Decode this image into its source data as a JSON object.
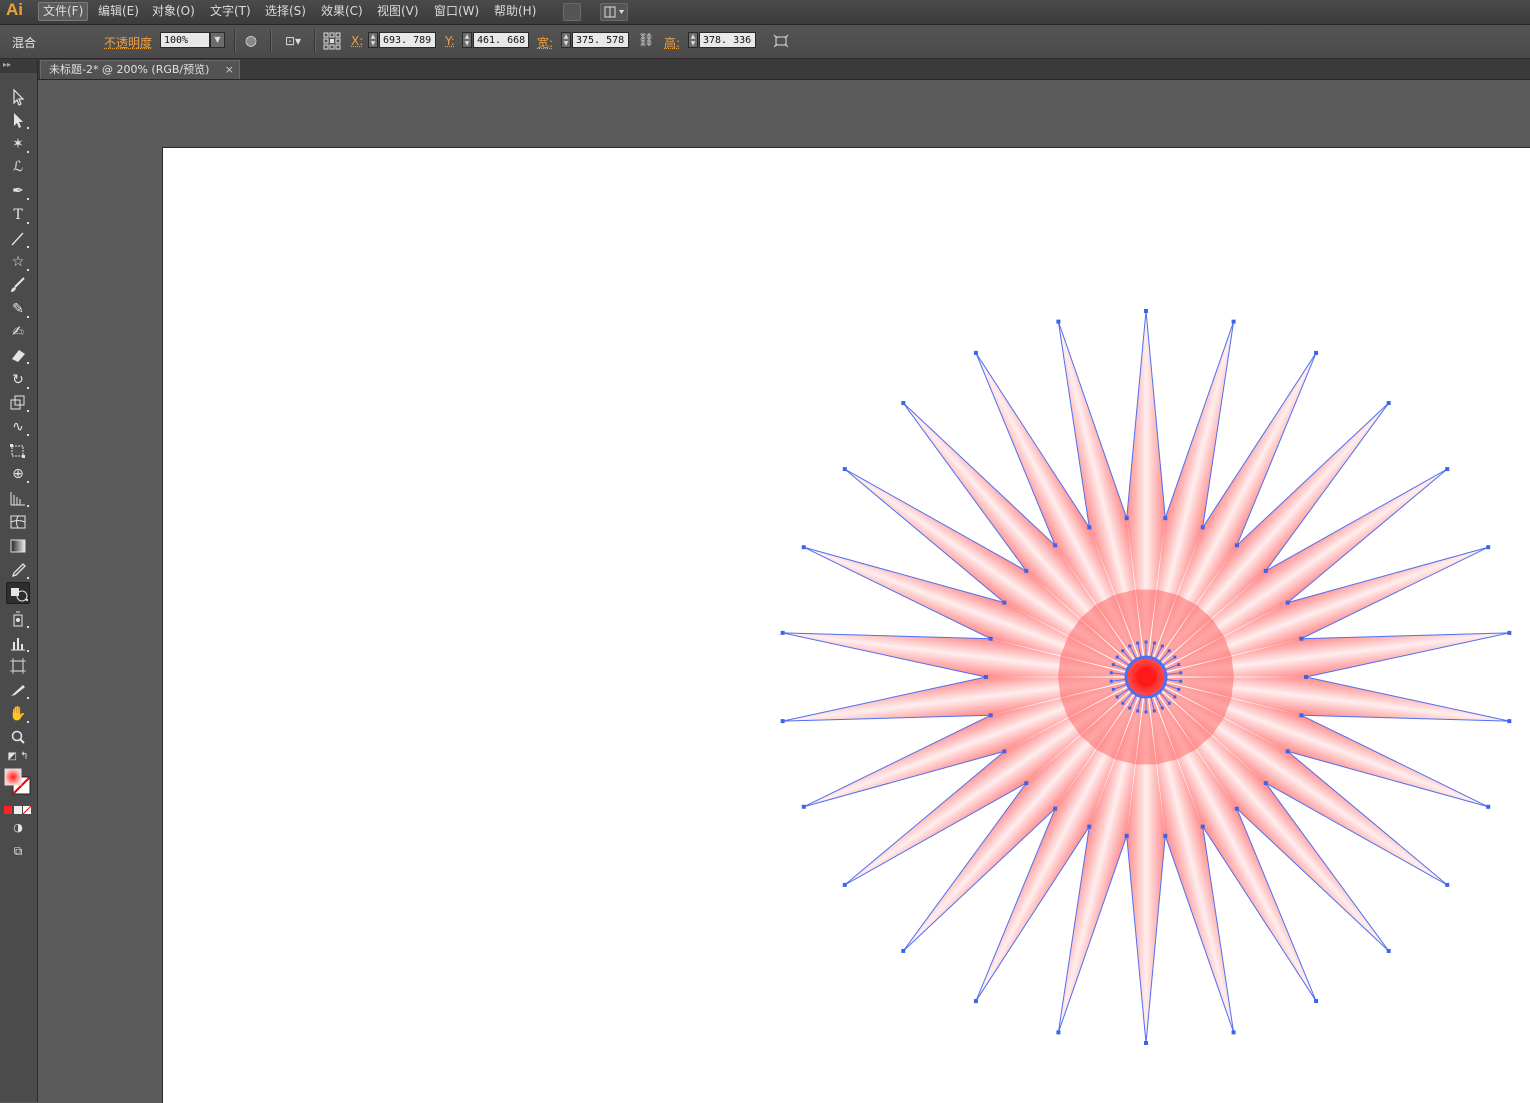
{
  "app": {
    "logo": "Ai"
  },
  "menu": {
    "items": [
      "文件(F)",
      "编辑(E)",
      "对象(O)",
      "文字(T)",
      "选择(S)",
      "效果(C)",
      "视图(V)",
      "窗口(W)",
      "帮助(H)"
    ],
    "active": "文件(F)"
  },
  "controlbar": {
    "panel_label": "混合",
    "opacity_label": "不透明度",
    "opacity_value": "100%",
    "x_label": "X:",
    "x_value": "693. 789",
    "y_label": "Y:",
    "y_value": "461. 668",
    "w_label": "宽:",
    "w_value": "375. 578",
    "h_label": "高:",
    "h_value": "378. 336"
  },
  "document": {
    "tab_title": "未标题-2* @ 200% (RGB/预览)",
    "close": "×"
  },
  "artwork": {
    "type": "blended-star",
    "points": 26,
    "fill_center_color": "#ff1a1a",
    "fill_ray_color": "#ff8a8a",
    "fill_edge_color": "#ffeeee",
    "path_color": "#4f6ff0",
    "anchor_color": "#3f63e8"
  },
  "colors": {
    "fill_swatch": "#ff2222",
    "accent": "#f0a040"
  }
}
